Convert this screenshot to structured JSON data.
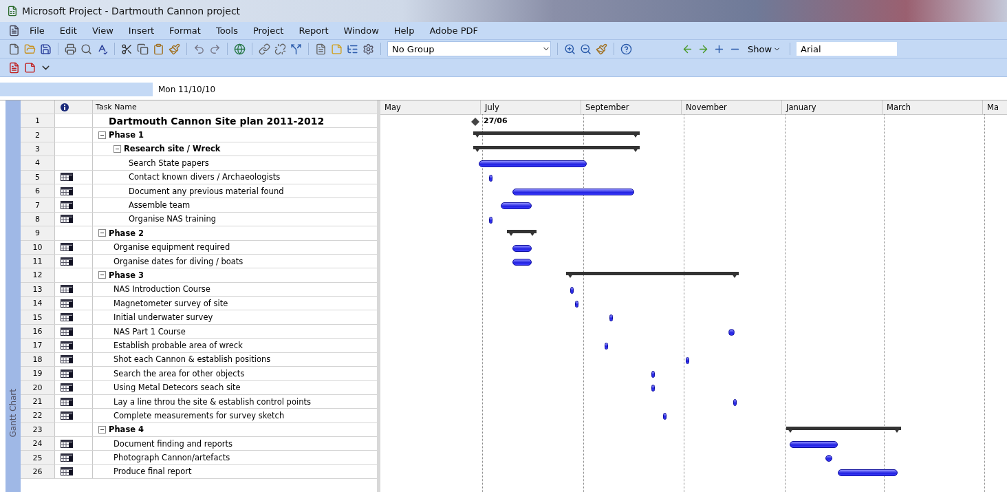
{
  "window": {
    "title": "Microsoft Project - Dartmouth Cannon project"
  },
  "menu": [
    "File",
    "Edit",
    "View",
    "Insert",
    "Format",
    "Tools",
    "Project",
    "Report",
    "Window",
    "Help",
    "Adobe PDF"
  ],
  "toolbar": {
    "group": "No Group",
    "show": "Show",
    "font": "Arial"
  },
  "entry_bar": {
    "value": "Mon 11/10/10"
  },
  "view_bar": {
    "label": "Gantt Chart"
  },
  "table": {
    "columns": [
      "Task Name"
    ],
    "rows": [
      {
        "id": "1",
        "name": "Dartmouth Cannon Site plan 2011-2012",
        "kind": "title",
        "indicator": false,
        "milestone_label": "27/06"
      },
      {
        "id": "2",
        "name": "Phase 1",
        "kind": "summary",
        "indicator": false,
        "expanded": true,
        "children": [
          {
            "id": "3",
            "name": "Research site / Wreck",
            "kind": "summary",
            "indicator": false,
            "expanded": true,
            "children": [
              {
                "id": "4",
                "name": "Search State papers",
                "kind": "task",
                "indicator": false
              },
              {
                "id": "5",
                "name": "Contact known divers / Archaeologists",
                "kind": "task",
                "indicator": true
              },
              {
                "id": "6",
                "name": "Document  any previous material found",
                "kind": "task",
                "indicator": true
              },
              {
                "id": "7",
                "name": "Assemble team",
                "kind": "task",
                "indicator": true
              },
              {
                "id": "8",
                "name": "Organise NAS training",
                "kind": "task",
                "indicator": true
              }
            ]
          }
        ]
      },
      {
        "id": "9",
        "name": "Phase 2",
        "kind": "summary",
        "indicator": false,
        "expanded": true,
        "children": [
          {
            "id": "10",
            "name": "Organise equipment required",
            "kind": "task",
            "indicator": true
          },
          {
            "id": "11",
            "name": "Organise dates for diving / boats",
            "kind": "task",
            "indicator": true
          }
        ]
      },
      {
        "id": "12",
        "name": "Phase 3",
        "kind": "summary",
        "indicator": false,
        "expanded": true,
        "children": [
          {
            "id": "13",
            "name": "NAS Introduction Course",
            "kind": "task",
            "indicator": true
          },
          {
            "id": "14",
            "name": "Magnetometer survey of site",
            "kind": "task",
            "indicator": true
          },
          {
            "id": "15",
            "name": "Initial underwater survey",
            "kind": "task",
            "indicator": true
          },
          {
            "id": "16",
            "name": "NAS Part 1 Course",
            "kind": "task",
            "indicator": true
          },
          {
            "id": "17",
            "name": "Establish probable area of wreck",
            "kind": "task",
            "indicator": true
          },
          {
            "id": "18",
            "name": "Shot each Cannon & establish positions",
            "kind": "task",
            "indicator": true
          },
          {
            "id": "19",
            "name": "Search the area for other objects",
            "kind": "task",
            "indicator": true
          },
          {
            "id": "20",
            "name": "Using Metal Detecors seach site",
            "kind": "task",
            "indicator": true
          },
          {
            "id": "21",
            "name": "Lay a line throu the site & establish control points",
            "kind": "task",
            "indicator": true
          },
          {
            "id": "22",
            "name": "Complete measurements for survey sketch",
            "kind": "task",
            "indicator": true
          }
        ]
      },
      {
        "id": "23",
        "name": "Phase 4",
        "kind": "summary",
        "indicator": false,
        "expanded": true,
        "children": [
          {
            "id": "24",
            "name": "Document finding and reports",
            "kind": "task",
            "indicator": true
          },
          {
            "id": "25",
            "name": "Photograph Cannon/artefacts",
            "kind": "task",
            "indicator": true
          },
          {
            "id": "26",
            "name": "Produce final report",
            "kind": "task",
            "indicator": true
          }
        ]
      }
    ]
  },
  "timescale": [
    "May",
    "July",
    "September",
    "November",
    "January",
    "March",
    "Ma"
  ]
}
